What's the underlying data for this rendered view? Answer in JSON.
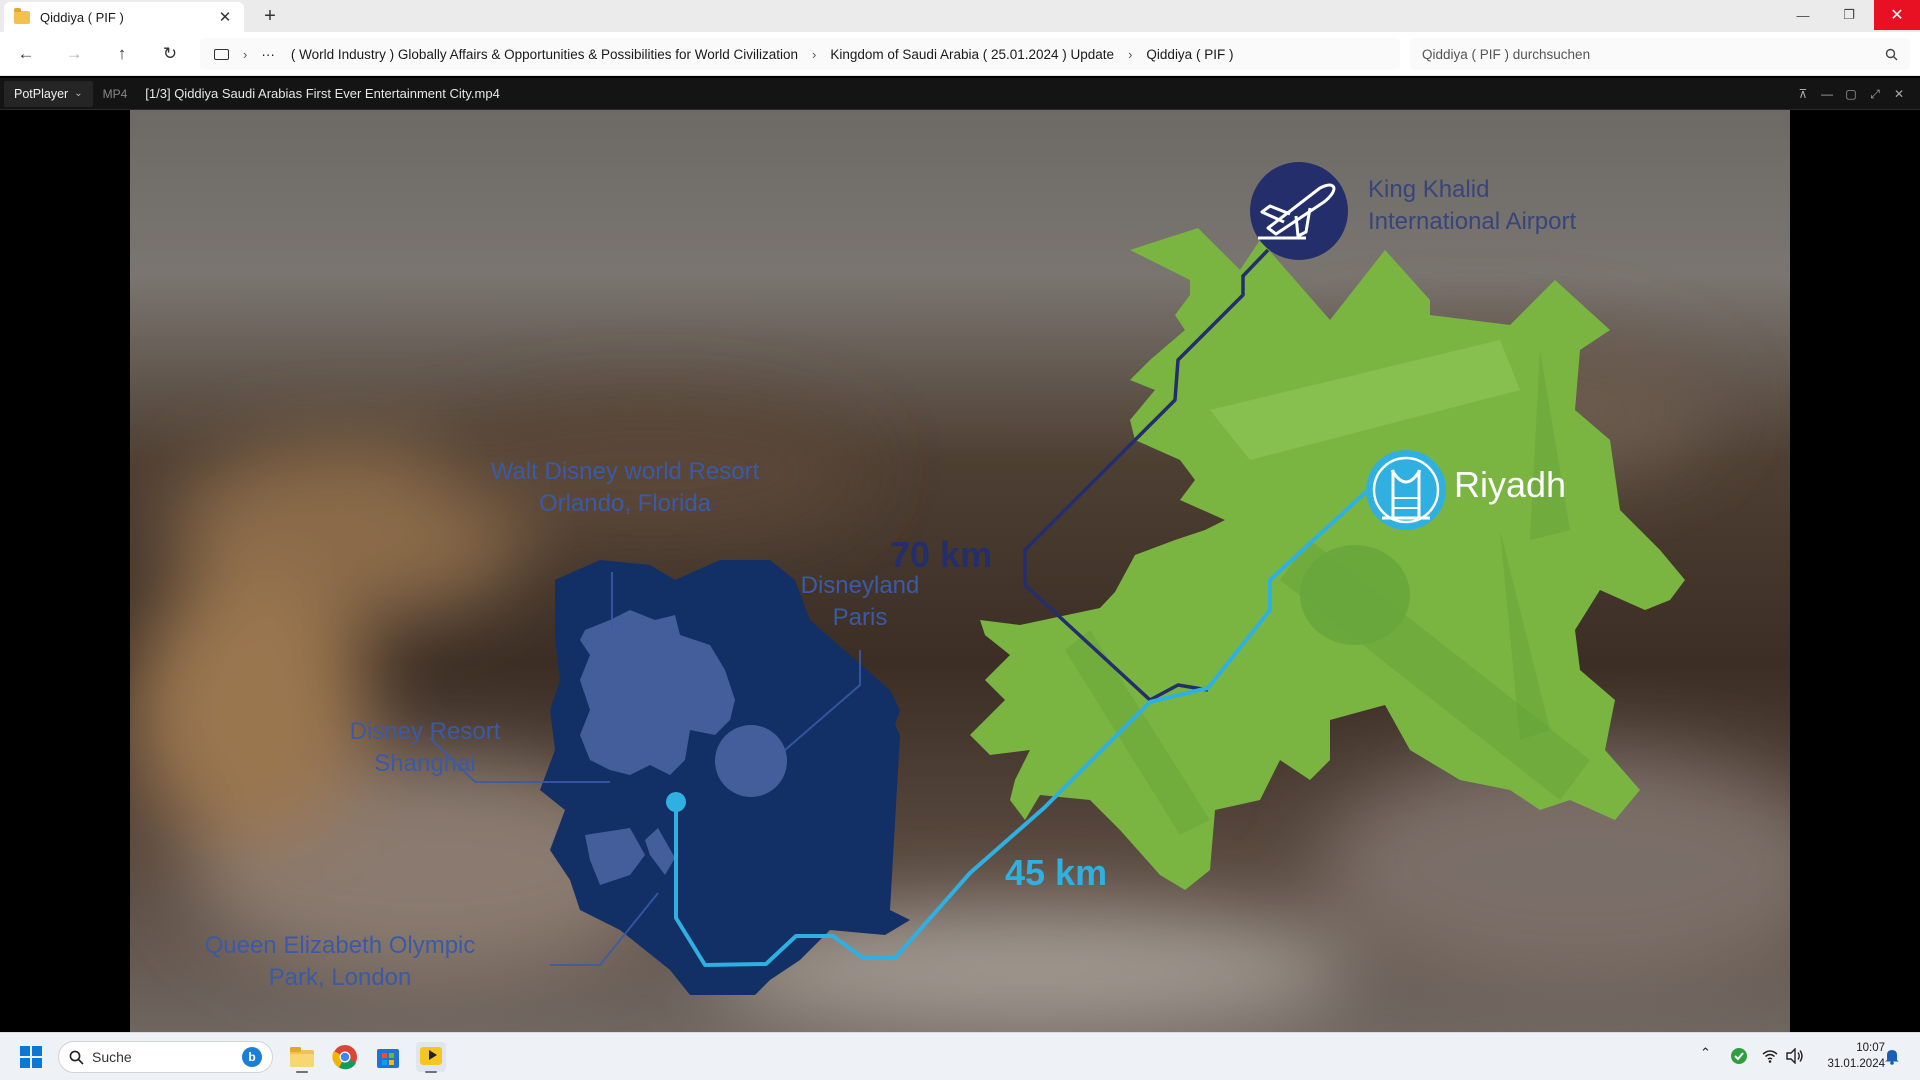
{
  "explorer": {
    "tab_title": "Qiddiya ( PIF )",
    "tab_close": "✕",
    "new_tab": "+",
    "window": {
      "minimize": "—",
      "maximize": "❐",
      "close": "✕"
    },
    "nav": {
      "back": "←",
      "forward": "→",
      "up": "↑",
      "refresh": "↻"
    },
    "breadcrumb": {
      "more": "···",
      "items": [
        "( World Industry ) Globally Affairs & Opportunities & Possibilities for World Civilization",
        "Kingdom of Saudi Arabia ( 25.01.2024 ) Update",
        "Qiddiya ( PIF )"
      ]
    },
    "search_placeholder": "Qiddiya ( PIF ) durchsuchen"
  },
  "player": {
    "app_label": "PotPlayer",
    "format": "MP4",
    "file_title": "[1/3] Qiddiya  Saudi Arabias First Ever Entertainment City.mp4"
  },
  "video": {
    "labels": {
      "airport_line1": "King Khalid",
      "airport_line2": "International Airport",
      "riyadh": "Riyadh",
      "disney_world_line1": "Walt Disney world Resort",
      "disney_world_line2": "Orlando, Florida",
      "disneyland_line1": "Disneyland",
      "disneyland_line2": "Paris",
      "shanghai_line1": "Disney Resort",
      "shanghai_line2": "Shanghai",
      "olympic_line1": "Queen Elizabeth Olympic",
      "olympic_line2": "Park, London",
      "distance_airport": "70 km",
      "distance_riyadh": "45 km"
    },
    "colors": {
      "riyadh_green": "#7ab542",
      "qiddiya_navy": "#123066",
      "route_cyan": "#2fb0e0",
      "route_navy": "#242e6a"
    }
  },
  "taskbar": {
    "search_placeholder": "Suche",
    "time": "10:07",
    "date": "31.01.2024"
  }
}
